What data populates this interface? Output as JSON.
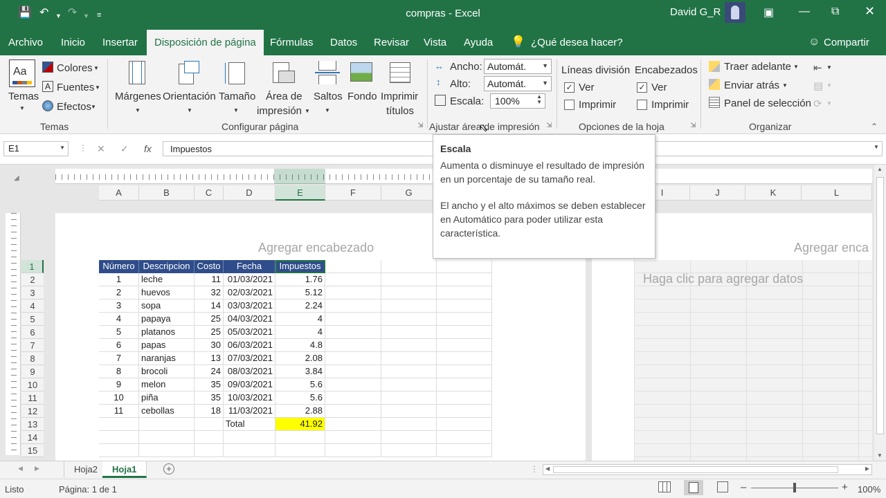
{
  "titlebar": {
    "title": "compras  -  Excel",
    "user": "David G_R"
  },
  "tabs": [
    "Archivo",
    "Inicio",
    "Insertar",
    "Disposición de página",
    "Fórmulas",
    "Datos",
    "Revisar",
    "Vista",
    "Ayuda"
  ],
  "tell_me": "¿Qué desea hacer?",
  "share": "Compartir",
  "ribbon": {
    "temas": {
      "temas": "Temas",
      "colores": "Colores",
      "fuentes": "Fuentes",
      "efectos": "Efectos",
      "group": "Temas"
    },
    "config": {
      "margenes": "Márgenes",
      "orientacion": "Orientación",
      "tamano": "Tamaño",
      "area1": "Área de",
      "area2": "impresión",
      "saltos": "Saltos",
      "fondo": "Fondo",
      "imprimir1": "Imprimir",
      "imprimir2": "títulos",
      "group": "Configurar página"
    },
    "ajustar": {
      "ancho": "Ancho:",
      "ancho_val": "Automát.",
      "alto": "Alto:",
      "alto_val": "Automát.",
      "escala": "Escala:",
      "escala_val": "100%",
      "group": "Ajustar área de impresión"
    },
    "opciones": {
      "lineas": "Líneas división",
      "encabezados": "Encabezados",
      "ver": "Ver",
      "imprimir": "Imprimir",
      "group": "Opciones de la hoja"
    },
    "organizar": {
      "traer": "Traer adelante",
      "enviar": "Enviar atrás",
      "panel": "Panel de selección",
      "group": "Organizar"
    }
  },
  "formula_bar": {
    "name_box": "E1",
    "formula": "Impuestos"
  },
  "columns": [
    "A",
    "B",
    "C",
    "D",
    "E",
    "F",
    "G"
  ],
  "right_columns": [
    "I",
    "J",
    "K",
    "L"
  ],
  "header_row": [
    "Número",
    "Descripcion",
    "Costo",
    "Fecha",
    "Impuestos"
  ],
  "rows": [
    [
      "1",
      "leche",
      "11",
      "01/03/2021",
      "1.76"
    ],
    [
      "2",
      "huevos",
      "32",
      "02/03/2021",
      "5.12"
    ],
    [
      "3",
      "sopa",
      "14",
      "03/03/2021",
      "2.24"
    ],
    [
      "4",
      "papaya",
      "25",
      "04/03/2021",
      "4"
    ],
    [
      "5",
      "platanos",
      "25",
      "05/03/2021",
      "4"
    ],
    [
      "6",
      "papas",
      "30",
      "06/03/2021",
      "4.8"
    ],
    [
      "7",
      "naranjas",
      "13",
      "07/03/2021",
      "2.08"
    ],
    [
      "8",
      "brocoli",
      "24",
      "08/03/2021",
      "3.84"
    ],
    [
      "9",
      "melon",
      "35",
      "09/03/2021",
      "5.6"
    ],
    [
      "10",
      "piña",
      "35",
      "10/03/2021",
      "5.6"
    ],
    [
      "11",
      "cebollas",
      "18",
      "11/03/2021",
      "2.88"
    ]
  ],
  "total": {
    "label": "Total",
    "value": "41.92"
  },
  "row_numbers": [
    "1",
    "2",
    "3",
    "4",
    "5",
    "6",
    "7",
    "8",
    "9",
    "10",
    "11",
    "12",
    "13",
    "14",
    "15"
  ],
  "page": {
    "add_header": "Agregar encabezado",
    "add_header_right": "Agregar enca",
    "add_data": "Haga clic para agregar datos"
  },
  "tooltip": {
    "title": "Escala",
    "p1": "Aumenta o disminuye el resultado de impresión en un porcentaje de su tamaño real.",
    "p2": "El ancho y el alto máximos se deben establecer en Automático para poder utilizar esta característica."
  },
  "sheets": [
    "Hoja2",
    "Hoja1"
  ],
  "status": {
    "ready": "Listo",
    "page": "Página: 1 de 1",
    "zoom": "100%"
  }
}
